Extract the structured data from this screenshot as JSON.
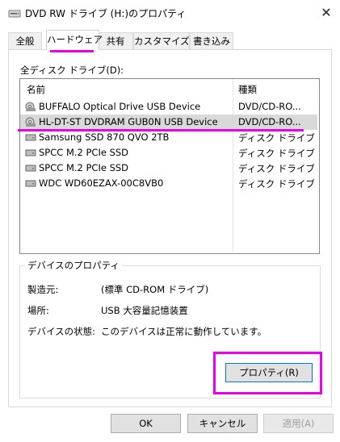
{
  "window": {
    "title": "DVD RW ドライブ (H:)のプロパティ",
    "close_glyph": "✕"
  },
  "tabs": [
    {
      "label": "全般"
    },
    {
      "label": "ハードウェア",
      "active": true
    },
    {
      "label": "共有"
    },
    {
      "label": "カスタマイズ"
    },
    {
      "label": "書き込み"
    }
  ],
  "drives": {
    "label": "全ディスク ドライブ(D):",
    "col_name": "名前",
    "col_type": "種類",
    "rows": [
      {
        "name": "BUFFALO Optical Drive USB Device",
        "type": "DVD/CD-RO...",
        "icon": "optical-drive-icon"
      },
      {
        "name": "HL-DT-ST DVDRAM GUB0N USB Device",
        "type": "DVD/CD-RO...",
        "icon": "optical-drive-icon",
        "selected": true
      },
      {
        "name": "Samsung SSD 870 QVO 2TB",
        "type": "ディスク ドライブ",
        "icon": "disk-drive-icon"
      },
      {
        "name": "SPCC M.2 PCIe SSD",
        "type": "ディスク ドライブ",
        "icon": "disk-drive-icon"
      },
      {
        "name": "SPCC M.2 PCIe SSD",
        "type": "ディスク ドライブ",
        "icon": "disk-drive-icon"
      },
      {
        "name": "WDC WD60EZAX-00C8VB0",
        "type": "ディスク ドライブ",
        "icon": "disk-drive-icon"
      }
    ]
  },
  "device_properties": {
    "legend": "デバイスのプロパティ",
    "manufacturer_label": "製造元:",
    "manufacturer_value": "(標準 CD-ROM ドライブ)",
    "location_label": "場所:",
    "location_value": "USB 大容量記憶装置",
    "status_label": "デバイスの状態:",
    "status_value": "このデバイスは正常に動作しています。",
    "properties_button": "プロパティ(R)"
  },
  "footer": {
    "ok": "OK",
    "cancel": "キャンセル",
    "apply": "適用(A)"
  },
  "colors": {
    "highlight": "#ee00ee",
    "selected_row": "#d9d9d9",
    "focus_border": "#0078d7"
  }
}
